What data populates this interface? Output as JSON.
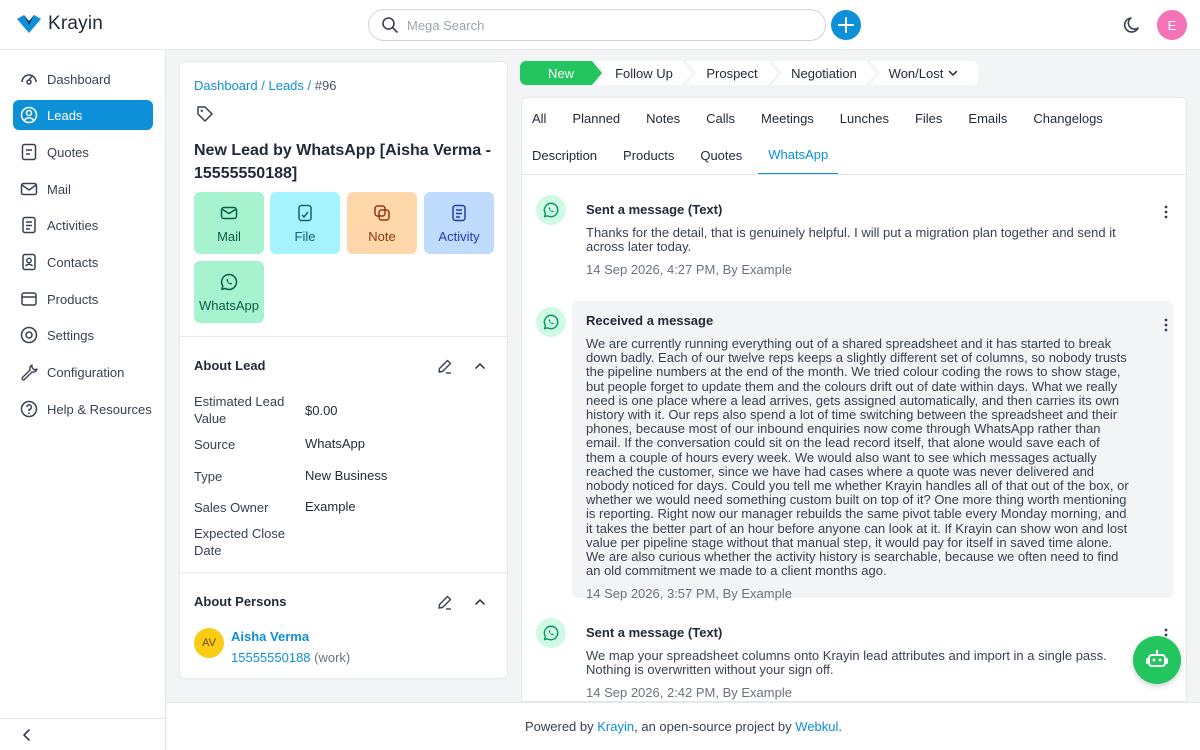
{
  "app": {
    "name": "Krayin",
    "user_initial": "E"
  },
  "search": {
    "placeholder": "Mega Search"
  },
  "sidebar": {
    "items": [
      {
        "label": "Dashboard",
        "icon": "dashboard-icon"
      },
      {
        "label": "Leads",
        "icon": "leads-icon",
        "active": true
      },
      {
        "label": "Quotes",
        "icon": "quotes-icon"
      },
      {
        "label": "Mail",
        "icon": "mail-icon"
      },
      {
        "label": "Activities",
        "icon": "activities-icon"
      },
      {
        "label": "Contacts",
        "icon": "contacts-icon"
      },
      {
        "label": "Products",
        "icon": "products-icon"
      },
      {
        "label": "Settings",
        "icon": "settings-icon"
      },
      {
        "label": "Configuration",
        "icon": "configuration-icon"
      },
      {
        "label": "Help & Resources",
        "icon": "help-icon"
      }
    ]
  },
  "breadcrumb": {
    "dashboard": "Dashboard",
    "leads": "Leads",
    "current": "#96",
    "sep": "/"
  },
  "lead": {
    "title": "New Lead by WhatsApp [Aisha Verma - 15555550188]"
  },
  "actions": {
    "mail": "Mail",
    "file": "File",
    "note": "Note",
    "activity": "Activity",
    "whatsapp": "WhatsApp"
  },
  "about_lead": {
    "heading": "About Lead",
    "rows": [
      {
        "label": "Estimated Lead Value",
        "value": "$0.00"
      },
      {
        "label": "Source",
        "value": "WhatsApp"
      },
      {
        "label": "Type",
        "value": "New Business"
      },
      {
        "label": "Sales Owner",
        "value": "Example"
      },
      {
        "label": "Expected Close Date",
        "value": ""
      }
    ]
  },
  "about_persons": {
    "heading": "About Persons",
    "initials": "AV",
    "name": "Aisha Verma",
    "phone": "15555550188",
    "phone_type": "(work)"
  },
  "stages": [
    "New",
    "Follow Up",
    "Prospect",
    "Negotiation",
    "Won/Lost"
  ],
  "tabs_row1": [
    "All",
    "Planned",
    "Notes",
    "Calls",
    "Meetings",
    "Lunches",
    "Files",
    "Emails",
    "Changelogs"
  ],
  "tabs_row2": [
    "Description",
    "Products",
    "Quotes",
    "WhatsApp"
  ],
  "messages": [
    {
      "title": "Sent a message (Text)",
      "body": "Thanks for the detail, that is genuinely helpful. I will put a migration plan together and send it across later today.",
      "meta": "14 Sep 2026, 4:27 PM, By Example"
    },
    {
      "title": "Received a message",
      "body": "We are currently running everything out of a shared spreadsheet and it has started to break down badly. Each of our twelve reps keeps a slightly different set of columns, so nobody trusts the pipeline numbers at the end of the month. We tried colour coding the rows to show stage, but people forget to update them and the colours drift out of date within days. What we really need is one place where a lead arrives, gets assigned automatically, and then carries its own history with it. Our reps also spend a lot of time switching between the spreadsheet and their phones, because most of our inbound enquiries now come through WhatsApp rather than email. If the conversation could sit on the lead record itself, that alone would save each of them a couple of hours every week. We would also want to see which messages actually reached the customer, since we have had cases where a quote was never delivered and nobody noticed for days. Could you tell me whether Krayin handles all of that out of the box, or whether we would need something custom built on top of it? One more thing worth mentioning is reporting. Right now our manager rebuilds the same pivot table every Monday morning, and it takes the better part of an hour before anyone can look at it. If Krayin can show won and lost value per pipeline stage without that manual step, it would pay for itself in saved time alone. We are also curious whether the activity history is searchable, because we often need to find an old commitment we made to a client months ago.",
      "meta": "14 Sep 2026, 3:57 PM, By Example"
    },
    {
      "title": "Sent a message (Text)",
      "body": "We map your spreadsheet columns onto Krayin lead attributes and import in a single pass. Nothing is overwritten without your sign off.",
      "meta": "14 Sep 2026, 2:42 PM, By Example"
    }
  ],
  "footer": {
    "prefix": "Powered by ",
    "krayin": "Krayin",
    "middle": ", an open-source project by ",
    "webkul": "Webkul",
    "suffix": "."
  },
  "colors": {
    "accent": "#0e90d9",
    "stage_active": "#22c55e",
    "whatsapp": "#22c55e"
  }
}
